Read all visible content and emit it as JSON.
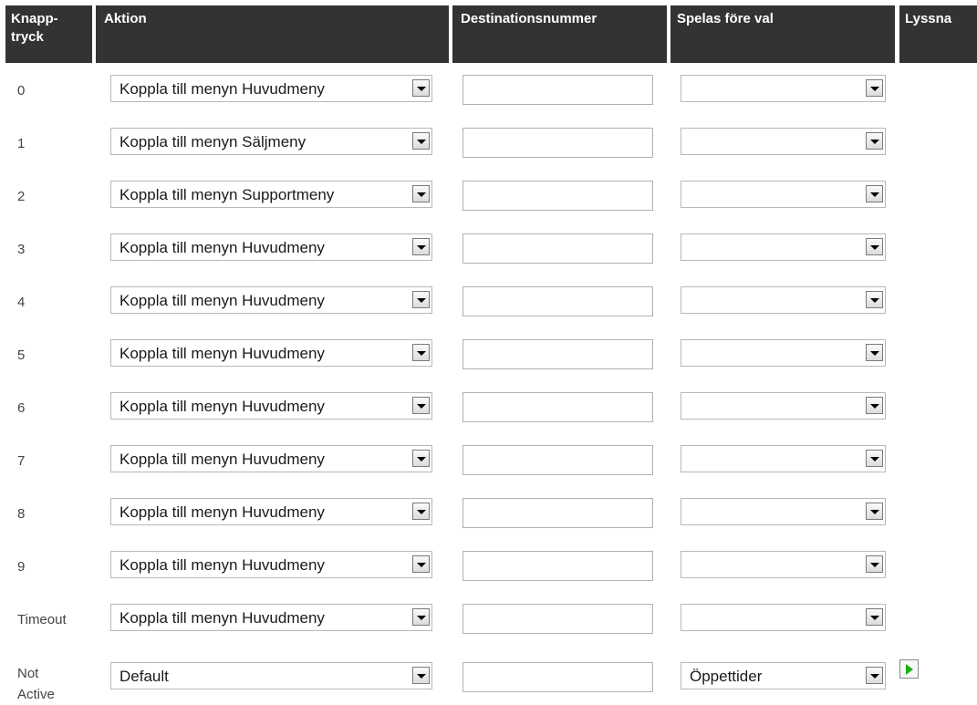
{
  "headers": {
    "key_line1": "Knapp-",
    "key_line2": "tryck",
    "action": "Aktion",
    "destination": "Destinationsnummer",
    "play_before": "Spelas före val",
    "listen": "Lyssna"
  },
  "rows": [
    {
      "key": "0",
      "action": "Koppla till menyn Huvudmeny",
      "destination": "",
      "play_before": ""
    },
    {
      "key": "1",
      "action": "Koppla till menyn Säljmeny",
      "destination": "",
      "play_before": ""
    },
    {
      "key": "2",
      "action": "Koppla till menyn Supportmeny",
      "destination": "",
      "play_before": ""
    },
    {
      "key": "3",
      "action": "Koppla till menyn Huvudmeny",
      "destination": "",
      "play_before": ""
    },
    {
      "key": "4",
      "action": "Koppla till menyn Huvudmeny",
      "destination": "",
      "play_before": ""
    },
    {
      "key": "5",
      "action": "Koppla till menyn Huvudmeny",
      "destination": "",
      "play_before": ""
    },
    {
      "key": "6",
      "action": "Koppla till menyn Huvudmeny",
      "destination": "",
      "play_before": ""
    },
    {
      "key": "7",
      "action": "Koppla till menyn Huvudmeny",
      "destination": "",
      "play_before": ""
    },
    {
      "key": "8",
      "action": "Koppla till menyn Huvudmeny",
      "destination": "",
      "play_before": ""
    },
    {
      "key": "9",
      "action": "Koppla till menyn Huvudmeny",
      "destination": "",
      "play_before": ""
    },
    {
      "key": "Timeout",
      "action": "Koppla till menyn Huvudmeny",
      "destination": "",
      "play_before": ""
    }
  ],
  "not_active": {
    "key_line1": "Not",
    "key_line2": "Active",
    "action": "Default",
    "destination": "",
    "play_before": "Öppettider",
    "listen_icon": "play-icon"
  },
  "colors": {
    "header_bg": "#333333",
    "header_text": "#ffffff",
    "play_green": "#1ab01a"
  }
}
